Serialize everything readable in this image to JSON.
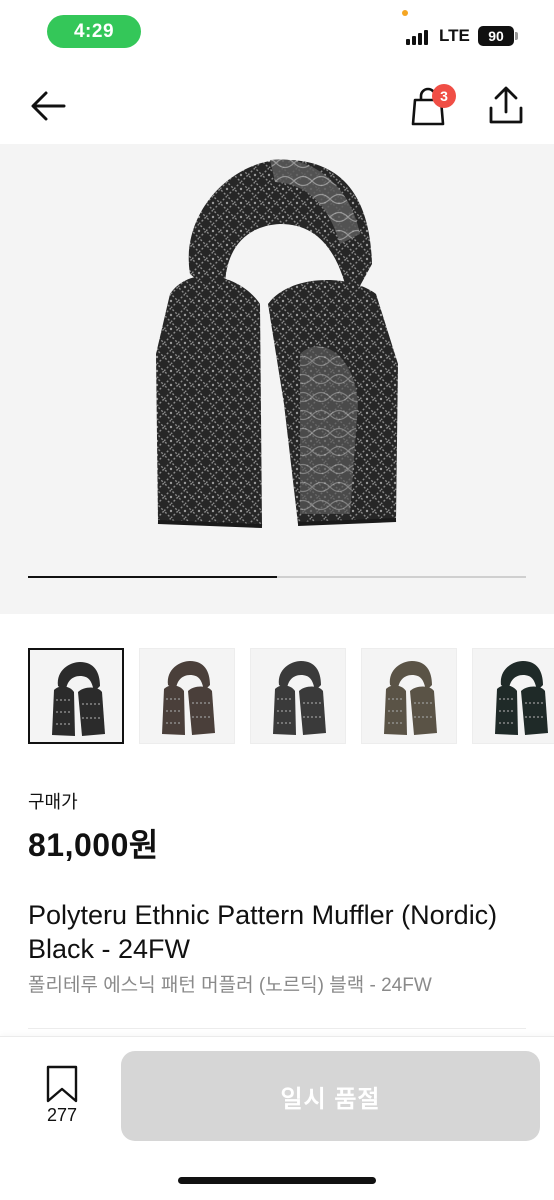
{
  "status_bar": {
    "time": "4:29",
    "network": "LTE",
    "battery": "90"
  },
  "nav": {
    "cart_count": "3"
  },
  "gallery": {
    "progress_fraction": 0.5,
    "thumbnail_colors": [
      "#2b2b2b",
      "#4a3f3a",
      "#3a3a3a",
      "#5a5346",
      "#1f2a28"
    ]
  },
  "product": {
    "price_label": "구매가",
    "price": "81,000원",
    "title_en": "Polyteru Ethnic Pattern Muffler (Nordic) Black - 24FW",
    "title_ko": "폴리테루 에스닉 패턴 머플러 (노르딕) 블랙 - 24FW"
  },
  "bottom_bar": {
    "bookmark_count": "277",
    "soldout_label": "일시 품절"
  },
  "colors": {
    "status_pill": "#34c759",
    "badge": "#f04e45",
    "disabled_button": "#d6d6d6"
  }
}
